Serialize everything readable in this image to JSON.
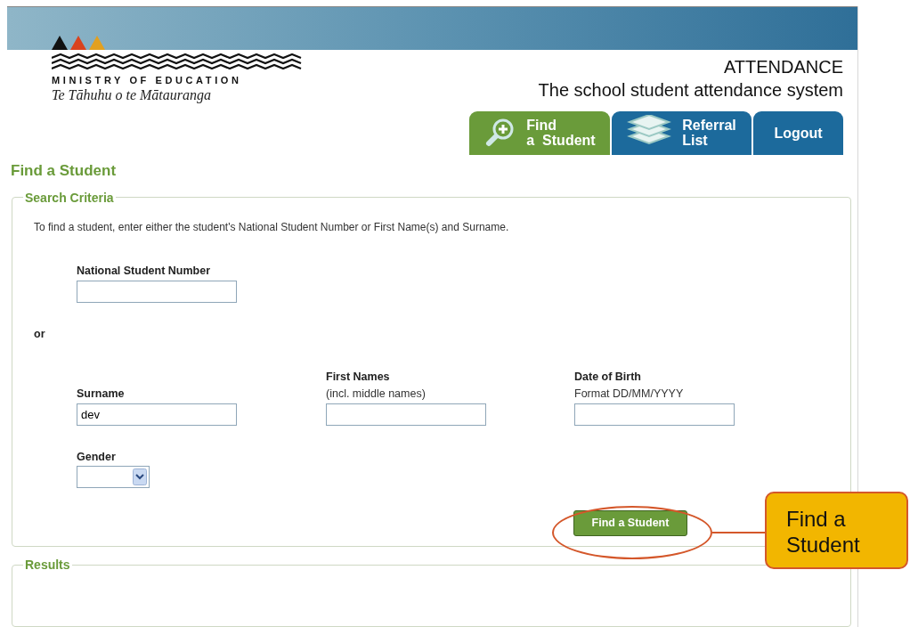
{
  "header": {
    "org_name": "MINISTRY OF EDUCATION",
    "org_subtitle": "Te Tāhuhu o te Mātauranga",
    "app_title": "ATTENDANCE",
    "app_subtitle": "The school student attendance system"
  },
  "nav_tabs": [
    {
      "kind": "search",
      "lines": [
        "Find",
        "a  Student"
      ],
      "selected": true
    },
    {
      "kind": "layers",
      "lines": [
        "Referral",
        "List"
      ],
      "selected": false
    },
    {
      "kind": "text",
      "lines": [
        "Logout"
      ],
      "selected": false
    }
  ],
  "page_title": "Find a Student",
  "search_criteria": {
    "legend": "Search Criteria",
    "instructions": "To find a student, enter either the student's National Student Number or First Name(s) and Surname.",
    "nsn": {
      "label": "National Student Number"
    },
    "separator": "or",
    "name_fields": [
      {
        "label": "Surname",
        "value": "dev"
      },
      {
        "label": "First Names",
        "hint": "(incl. middle names)"
      },
      {
        "label": "Date of Birth",
        "hint": "Format DD/MM/YYYY"
      }
    ],
    "gender": {
      "label": "Gender"
    },
    "button": "Find a Student"
  },
  "results": {
    "legend": "Results"
  },
  "callout": {
    "text": "Find a Student"
  }
}
